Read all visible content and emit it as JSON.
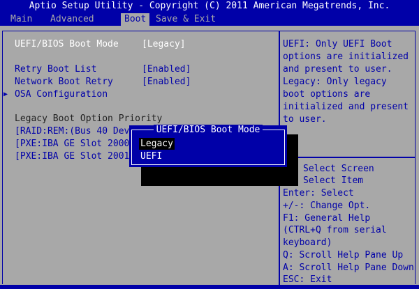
{
  "header": {
    "title": "Aptio Setup Utility - Copyright (C) 2011 American Megatrends, Inc."
  },
  "tabs": [
    {
      "label": "Main"
    },
    {
      "label": "Advanced"
    },
    {
      "label": "Boot"
    },
    {
      "label": "Save & Exit"
    }
  ],
  "settings": {
    "boot_mode": {
      "label": "UEFI/BIOS Boot Mode",
      "value": "[Legacy]"
    },
    "retry_boot_list": {
      "label": "Retry Boot List",
      "value": "[Enabled]"
    },
    "network_boot_retry": {
      "label": "Network Boot Retry",
      "value": "[Enabled]"
    },
    "osa_config": {
      "arrow": "▶",
      "label": "OSA Configuration"
    },
    "legacy_priority_heading": "Legacy Boot Option Priority",
    "boot_options": [
      "[RAID:REM:(Bus 40 Dev",
      "[PXE:IBA GE Slot 2000",
      "[PXE:IBA GE Slot 2001"
    ]
  },
  "help": {
    "description": [
      "UEFI: Only UEFI Boot",
      "options are initialized",
      "and present to user.",
      "Legacy: Only legacy",
      "boot options are",
      "initialized and present",
      "to user."
    ],
    "keys": [
      "Select Screen",
      "Select Item",
      "Enter: Select",
      "+/-: Change Opt.",
      "F1: General Help",
      "(CTRL+Q from serial",
      "keyboard)",
      "Q: Scroll Help Pane Up",
      "A: Scroll Help Pane Down",
      "ESC: Exit"
    ]
  },
  "dialog": {
    "title": "UEFI/BIOS Boot Mode",
    "options": [
      {
        "label": "Legacy"
      },
      {
        "label": "UEFI"
      }
    ]
  }
}
